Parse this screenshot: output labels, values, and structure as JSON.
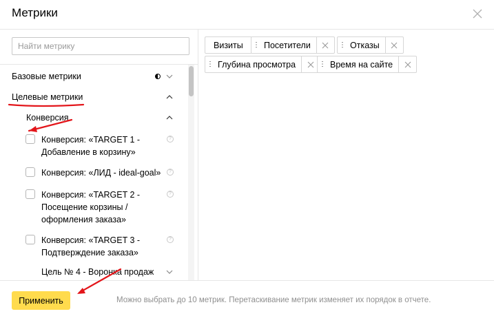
{
  "dialog": {
    "title": "Метрики"
  },
  "search": {
    "placeholder": "Найти метрику"
  },
  "groups": {
    "basic": "Базовые метрики",
    "goal": "Целевые метрики",
    "conversion": "Конверсия",
    "goal4": "Цель № 4 - Воронка продаж"
  },
  "items": [
    {
      "line1": "Конверсия: «TARGET 1 -",
      "line2": "Добавление в корзину»",
      "line3": "",
      "checked": false
    },
    {
      "line1": "Конверсия: «ЛИД - ideal-goal»",
      "line2": "",
      "line3": "",
      "checked": false
    },
    {
      "line1": "Конверсия: «TARGET 2 -",
      "line2": "Посещение корзины /",
      "line3": "оформления заказа»",
      "checked": false
    },
    {
      "line1": "Конверсия: «TARGET 3 -",
      "line2": "Подтверждение заказа»",
      "line3": "",
      "checked": false
    }
  ],
  "selected": {
    "visits": "Визиты",
    "visitors": "Посетители",
    "bounces": "Отказы",
    "depth": "Глубина просмотра",
    "time": "Время на сайте"
  },
  "footer": {
    "apply_label": "Применить",
    "hint": "Можно выбрать до 10 метрик. Перетаскивание метрик изменяет их порядок в отчете."
  },
  "colors": {
    "accent": "#ffdb4d",
    "annotation": "#e3151a"
  }
}
